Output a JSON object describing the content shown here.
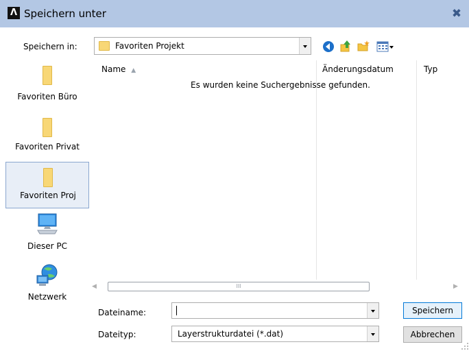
{
  "window": {
    "title": "Speichern unter",
    "close_symbol": "✖",
    "app_icon_glyph": "Λ"
  },
  "save_in": {
    "label": "Speichern in:",
    "value": "Favoriten Projekt"
  },
  "places": [
    {
      "label": "Favoriten Büro",
      "icon": "folder-icon"
    },
    {
      "label": "Favoriten Privat",
      "icon": "folder-icon"
    },
    {
      "label": "Favoriten Proj",
      "icon": "folder-icon",
      "selected": true
    },
    {
      "label": "Dieser PC",
      "icon": "computer-icon"
    },
    {
      "label": "Netzwerk",
      "icon": "network-icon"
    }
  ],
  "list": {
    "columns": [
      "Name",
      "Änderungsdatum",
      "Typ"
    ],
    "empty_message": "Es wurden keine Suchergebnisse gefunden.",
    "scroll_thumb_glyph": "III"
  },
  "file_name": {
    "label": "Dateiname:",
    "value": ""
  },
  "file_type": {
    "label": "Dateityp:",
    "value": "Layerstrukturdatei (*.dat)"
  },
  "buttons": {
    "save": "Speichern",
    "cancel": "Abbrechen"
  },
  "colors": {
    "titlebar": "#b3c7e4",
    "selected_place": "#e8eef7",
    "default_button_border": "#0078d7"
  }
}
